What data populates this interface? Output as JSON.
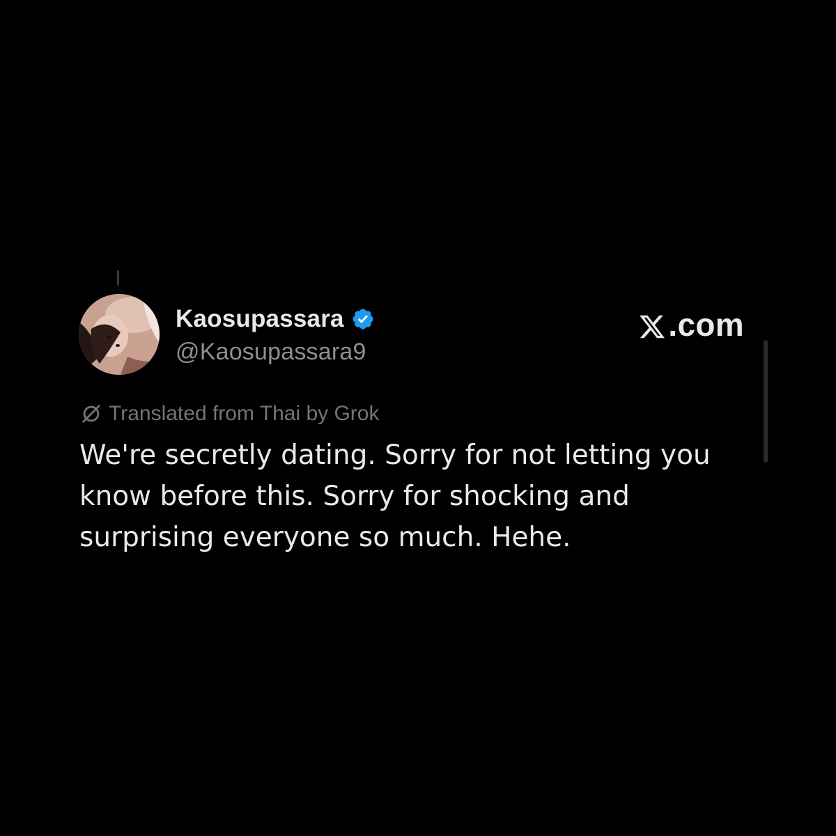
{
  "post": {
    "author": {
      "display_name": "Kaosupassara",
      "handle": "@Kaosupassara9",
      "verified_icon": "verified-badge-icon",
      "verified_color": "#1d9bf0"
    },
    "brand": {
      "text": ".com",
      "icon": "x-logo-icon"
    },
    "translation": {
      "label": "Translated from Thai by Grok",
      "icon": "grok-icon"
    },
    "text_lines": [
      "We're secretly dating. Sorry for not letting you",
      "know before this. Sorry for shocking and",
      "surprising everyone so much. Hehe."
    ]
  },
  "colors": {
    "background": "#000000",
    "primary_text": "#e7e9ea",
    "secondary_text": "#8b8f94"
  }
}
